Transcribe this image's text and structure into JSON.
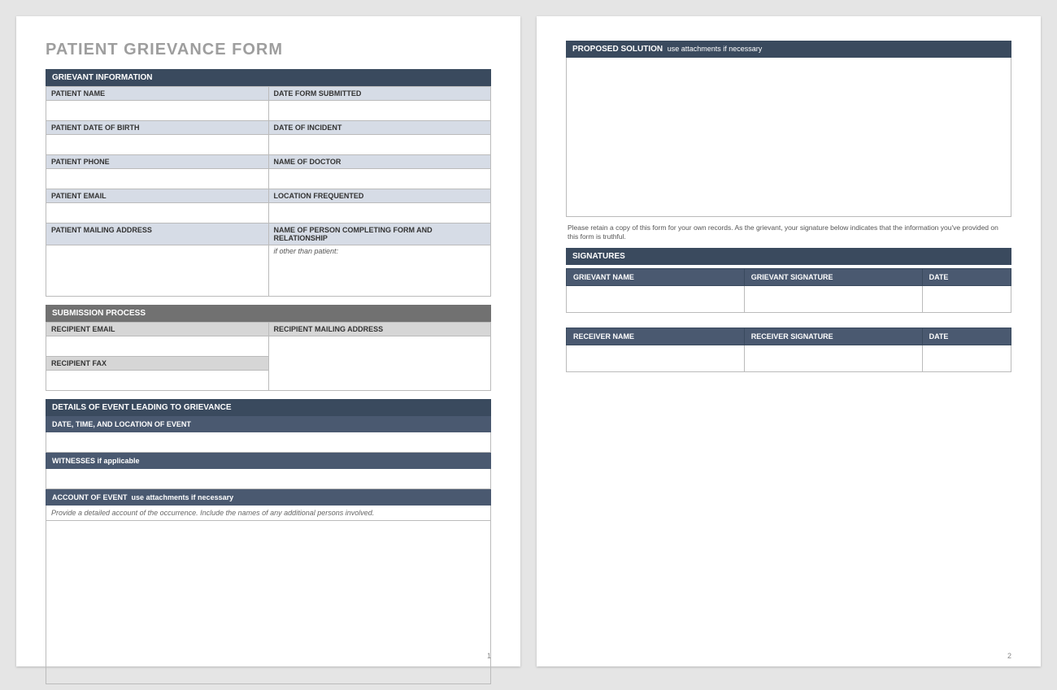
{
  "title": "PATIENT GRIEVANCE FORM",
  "sec": {
    "grievant": "GRIEVANT INFORMATION",
    "submission": "SUBMISSION PROCESS",
    "details": "DETAILS OF EVENT LEADING TO GRIEVANCE",
    "proposed": "PROPOSED SOLUTION",
    "proposed_sub": "use attachments if necessary",
    "signatures": "SIGNATURES"
  },
  "labels": {
    "patientName": "PATIENT NAME",
    "dateSubmitted": "DATE FORM SUBMITTED",
    "patientDob": "PATIENT DATE OF BIRTH",
    "dateIncident": "DATE OF INCIDENT",
    "patientPhone": "PATIENT PHONE",
    "doctor": "NAME OF DOCTOR",
    "patientEmail": "PATIENT EMAIL",
    "location": "LOCATION FREQUENTED",
    "mailing": "PATIENT MAILING ADDRESS",
    "completing": "NAME OF PERSON COMPLETING FORM AND RELATIONSHIP",
    "completingHint": "if other than patient:",
    "recipEmail": "RECIPIENT EMAIL",
    "recipMailing": "RECIPIENT MAILING ADDRESS",
    "recipFax": "RECIPIENT FAX",
    "dateTimeLoc": "DATE, TIME, AND LOCATION OF EVENT",
    "witnesses": "WITNESSES",
    "witnesses_sub": "if applicable",
    "account": "ACCOUNT OF EVENT",
    "account_sub": "use attachments if necessary",
    "accountHint": "Provide a detailed account of the occurrence. Include the names of any additional persons involved."
  },
  "disclaimer": "Please retain a copy of this form for your own records.  As the grievant, your signature below indicates that the information you've provided on this form is truthful.",
  "sig": {
    "grievantName": "GRIEVANT NAME",
    "grievantSig": "GRIEVANT SIGNATURE",
    "date": "DATE",
    "receiverName": "RECEIVER NAME",
    "receiverSig": "RECEIVER SIGNATURE"
  },
  "pageno": {
    "p1": "1",
    "p2": "2"
  }
}
